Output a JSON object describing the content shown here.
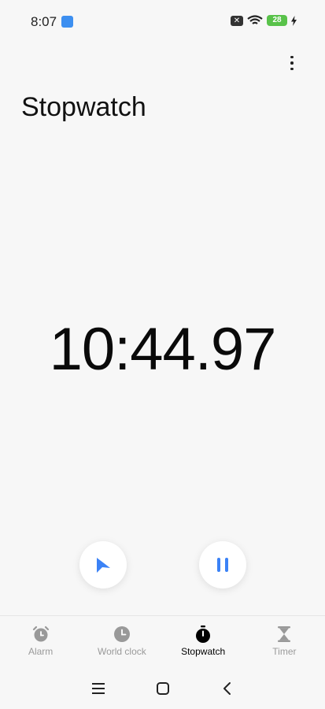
{
  "status_bar": {
    "time": "8:07",
    "battery": "28"
  },
  "app": {
    "title": "Stopwatch"
  },
  "stopwatch": {
    "time": "10:44.97"
  },
  "controls": {
    "lap_icon": "flag-icon",
    "pause_icon": "pause-icon",
    "accent": "#3b82f6"
  },
  "nav": {
    "tabs": [
      {
        "label": "Alarm",
        "icon": "alarm-icon",
        "active": false
      },
      {
        "label": "World clock",
        "icon": "clock-icon",
        "active": false
      },
      {
        "label": "Stopwatch",
        "icon": "stopwatch-icon",
        "active": true
      },
      {
        "label": "Timer",
        "icon": "hourglass-icon",
        "active": false
      }
    ]
  }
}
